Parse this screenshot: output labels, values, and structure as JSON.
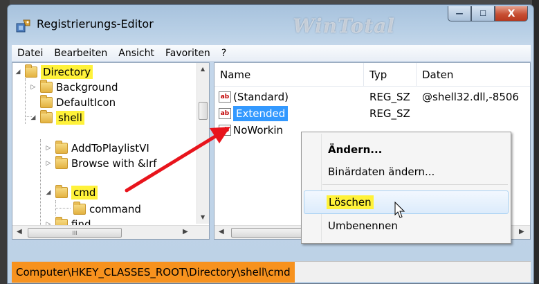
{
  "window": {
    "title": "Registrierungs-Editor",
    "watermark": "WinTotal"
  },
  "titlebar_buttons": {
    "minimize": "—",
    "maximize": "☐",
    "close": "X"
  },
  "menu": [
    "Datei",
    "Bearbeiten",
    "Ansicht",
    "Favoriten",
    "?"
  ],
  "tree": {
    "items": [
      {
        "label": "Directory",
        "expander": "◢",
        "highlighted": true
      },
      {
        "label": "Background",
        "expander": "▷",
        "highlighted": false
      },
      {
        "label": "DefaultIcon",
        "expander": "",
        "highlighted": false
      },
      {
        "label": "shell",
        "expander": "◢",
        "highlighted": true
      },
      {
        "label": "AddToPlaylistVI",
        "expander": "▷",
        "highlighted": false
      },
      {
        "label": "Browse with &Irf",
        "expander": "▷",
        "highlighted": false
      },
      {
        "label": "cmd",
        "expander": "◢",
        "highlighted": true
      },
      {
        "label": "command",
        "expander": "",
        "highlighted": false
      },
      {
        "label": "find",
        "expander": "▷",
        "highlighted": false
      }
    ],
    "hscroll_thumb": "III"
  },
  "list": {
    "columns": {
      "name": "Name",
      "type": "Typ",
      "data": "Daten"
    },
    "rows": [
      {
        "icon": "ab",
        "name": "(Standard)",
        "type": "REG_SZ",
        "data": "@shell32.dll,-8506"
      },
      {
        "icon": "ab",
        "name": "Extended",
        "type": "REG_SZ",
        "data": ""
      },
      {
        "icon": "ab",
        "name": "NoWorkin",
        "type": "",
        "data": ""
      }
    ],
    "hscroll_thumb": "III"
  },
  "context_menu": {
    "items": [
      "Ändern...",
      "Binärdaten ändern...",
      "Löschen",
      "Umbenennen"
    ],
    "hovered": "Löschen"
  },
  "status_bar": {
    "path": "Computer\\HKEY_CLASSES_ROOT\\Directory\\shell\\cmd"
  },
  "colors": {
    "highlight": "#fff23a",
    "selection": "#3399ff",
    "status_highlight": "#f7921e",
    "arrow": "#e8141c"
  }
}
